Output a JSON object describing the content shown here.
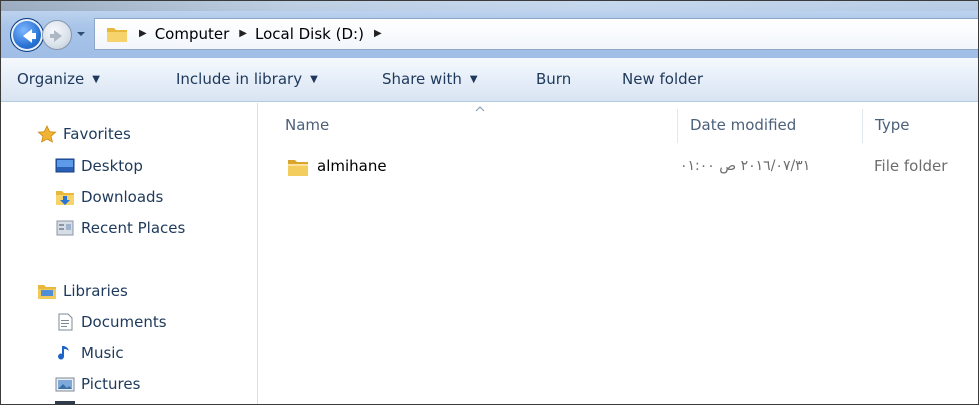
{
  "navigation": {
    "back_icon": "back-arrow-icon",
    "forward_icon": "forward-arrow-icon",
    "history_icon": "chevron-down-icon"
  },
  "address": {
    "folder_icon": "folder-icon",
    "crumbs": [
      "Computer",
      "Local Disk (D:)"
    ]
  },
  "toolbar": {
    "organize": "Organize",
    "include_in_library": "Include in library",
    "share_with": "Share with",
    "burn": "Burn",
    "new_folder": "New folder"
  },
  "sidebar": {
    "favorites": {
      "label": "Favorites",
      "icon": "star-icon",
      "items": [
        {
          "label": "Desktop",
          "icon": "desktop-icon"
        },
        {
          "label": "Downloads",
          "icon": "downloads-folder-icon"
        },
        {
          "label": "Recent Places",
          "icon": "recent-places-icon"
        }
      ]
    },
    "libraries": {
      "label": "Libraries",
      "icon": "libraries-icon",
      "items": [
        {
          "label": "Documents",
          "icon": "document-icon"
        },
        {
          "label": "Music",
          "icon": "music-note-icon"
        },
        {
          "label": "Pictures",
          "icon": "pictures-icon"
        }
      ]
    }
  },
  "columns": {
    "name": "Name",
    "date_modified": "Date modified",
    "type": "Type"
  },
  "files": [
    {
      "name": "almihane",
      "date_modified": "٢٠١٦/٠٧/٣١ ص ٠١:٠٠",
      "type": "File folder",
      "icon": "folder-icon"
    }
  ],
  "colors": {
    "accent": "#1e395b",
    "folder": "#e8b83c",
    "selection_blue": "#2a74d6"
  }
}
